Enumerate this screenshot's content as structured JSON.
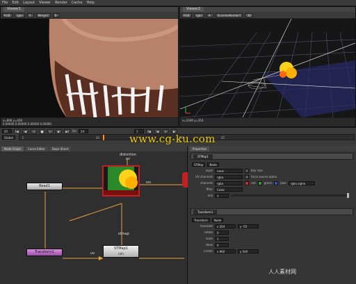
{
  "menu": [
    "File",
    "Edit",
    "Layout",
    "Viewer",
    "Render",
    "Cache",
    "Help"
  ],
  "viewer1": {
    "tab": "Viewer1",
    "toolbar": [
      "RGB",
      "rgba",
      "A",
      "Merge2",
      "B"
    ],
    "status_line1": "x=896 y=458",
    "status_line2": "0.00000 0.00000 0.00000 0.00000"
  },
  "viewer2": {
    "tab": "Viewer2",
    "toolbar": [
      "RGB",
      "rgba",
      "A",
      "ScanlineRender1",
      "3D"
    ],
    "status_line1": "x=1049 y=354"
  },
  "timeline": {
    "fps_label": "fps",
    "fps_value": "24",
    "frame_left": "25",
    "frame_right": "1",
    "global_label": "Global",
    "global_value_right": "1",
    "ruler_marks": [
      "1",
      "10",
      "20",
      "25"
    ]
  },
  "nodegraph": {
    "tabs": [
      "Node Graph",
      "Curve Editor",
      "Dope Sheet"
    ],
    "nodes": {
      "read": "Read1",
      "transform": "Transform1",
      "stmap": "STMap1",
      "stmap_sub": "(all)"
    },
    "labels": {
      "dist_uv": "distortion\nuv",
      "src": "src",
      "stmap_in": "stmap",
      "uv": "uv"
    }
  },
  "properties": {
    "title": "Properties",
    "tabs": [
      "STMap",
      "Node"
    ],
    "node_name": "STMap1",
    "rows": [
      {
        "label": "input",
        "field": "none",
        "extra": "blur size"
      },
      {
        "label": "UV channels",
        "field": "rgba",
        "extra": "force source alpha"
      },
      {
        "label": "channels",
        "field": "rgba",
        "r": "red",
        "g": "green",
        "b": "blue",
        "a": "rgba.alpha"
      },
      {
        "label": "filter",
        "field": "Cubic"
      },
      {
        "label": "mix",
        "field": "1"
      }
    ],
    "transform_header": "Transform1",
    "transform_tabs": [
      "Transform",
      "Node"
    ],
    "transform_rows": [
      {
        "label": "translate",
        "x": "x 204",
        "y": "y -55"
      },
      {
        "label": "rotate",
        "x": "0"
      },
      {
        "label": "scale",
        "x": "1"
      },
      {
        "label": "skew",
        "x": "0"
      },
      {
        "label": "center",
        "x": "x 960",
        "y": "y 540"
      }
    ]
  },
  "watermark": "www.cg-ku.com",
  "watermark2": "人人素材网"
}
